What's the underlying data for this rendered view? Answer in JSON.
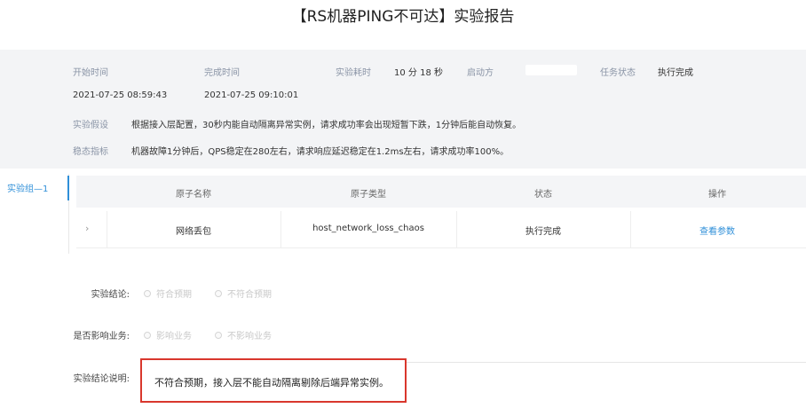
{
  "title": "【RS机器PING不可达】实验报告",
  "summary": {
    "start_label": "开始时间",
    "start_value": "2021-07-25 08:59:43",
    "end_label": "完成时间",
    "end_value": "2021-07-25 09:10:01",
    "duration_label": "实验耗时",
    "duration_value": "10 分 18 秒",
    "initiator_label": "启动方",
    "status_label": "任务状态",
    "status_value": "执行完成",
    "hypothesis_label": "实验假设",
    "hypothesis_value": "根据接入层配置，30秒内能自动隔离异常实例，请求成功率会出现短暂下跌，1分钟后能自动恢复。",
    "metric_label": "稳态指标",
    "metric_value": "机器故障1分钟后，QPS稳定在280左右，请求响应延迟稳定在1.2ms左右，请求成功率100%。"
  },
  "group_tab": "实验组—1",
  "table": {
    "headers": [
      "原子名称",
      "原子类型",
      "状态",
      "操作"
    ],
    "rows": [
      {
        "expand": "›",
        "name": "网络丢包",
        "type": "host_network_loss_chaos",
        "status": "执行完成",
        "action": "查看参数"
      }
    ]
  },
  "conclusion": {
    "label": "实验结论:",
    "options": [
      "符合预期",
      "不符合预期"
    ]
  },
  "impact": {
    "label": "是否影响业务:",
    "options": [
      "影响业务",
      "不影响业务"
    ]
  },
  "note": {
    "label": "实验结论说明:",
    "text": "不符合预期，接入层不能自动隔离剔除后端异常实例。"
  }
}
